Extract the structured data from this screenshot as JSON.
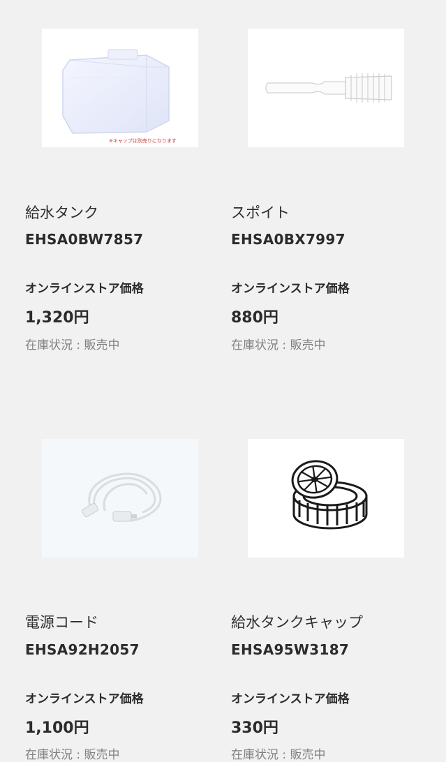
{
  "products": [
    {
      "name": "給水タンク",
      "code": "EHSA0BW7857",
      "price_label": "オンラインストア価格",
      "price": "1,320円",
      "stock": "在庫状況 : 販売中",
      "image_note": "※キャップは別売りになります",
      "icon": "water-tank-icon"
    },
    {
      "name": "スポイト",
      "code": "EHSA0BX7997",
      "price_label": "オンラインストア価格",
      "price": "880円",
      "stock": "在庫状況 : 販売中",
      "icon": "dropper-icon"
    },
    {
      "name": "電源コード",
      "code": "EHSA92H2057",
      "price_label": "オンラインストア価格",
      "price": "1,100円",
      "stock": "在庫状況 : 販売中",
      "icon": "power-cord-icon"
    },
    {
      "name": "給水タンクキャップ",
      "code": "EHSA95W3187",
      "price_label": "オンラインストア価格",
      "price": "330円",
      "stock": "在庫状況 : 販売中",
      "icon": "tank-cap-icon"
    }
  ]
}
